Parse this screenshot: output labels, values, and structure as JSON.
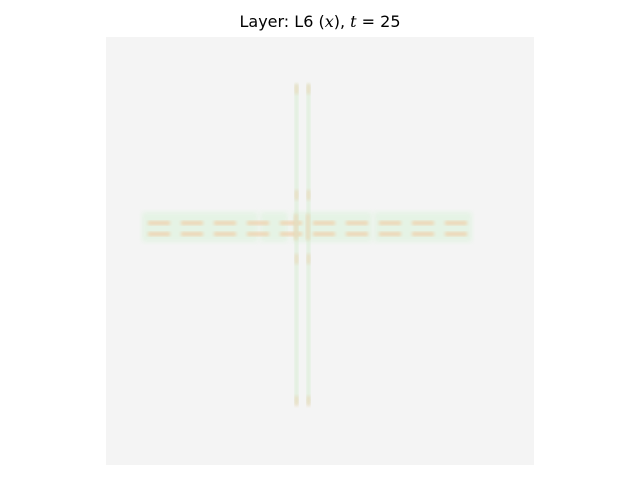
{
  "title_parts": {
    "prefix": "Layer: L6 (",
    "var_x": "x",
    "middle": "), ",
    "var_t": "t",
    "suffix": " = 25"
  },
  "chart_data": {
    "type": "heatmap",
    "title": "Layer: L6 (x), t = 25",
    "background_value_color": "#f4f4f4",
    "colors": {
      "faint_green": "#e4f3e4",
      "light_green": "#d8ecd4",
      "tan": "#ead8b8",
      "orange_tan": "#f0cfa8"
    },
    "grid": false,
    "axes_visible": false
  }
}
